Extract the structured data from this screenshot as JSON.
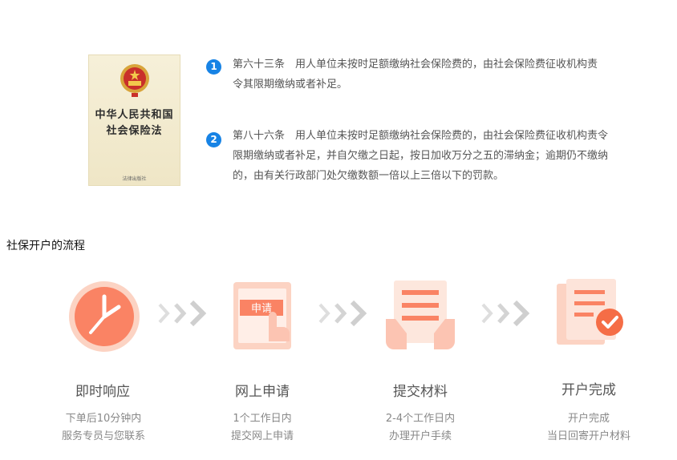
{
  "book": {
    "title_line1": "中华人民共和国",
    "title_line2": "社会保险法",
    "publisher": "法律出版社"
  },
  "articles": [
    {
      "number": "1",
      "line1": "第六十三条　用人单位未按时足额缴纳社会保险费的，由社会保险费征收机构责",
      "line2": "令其限期缴纳或者补足。"
    },
    {
      "number": "2",
      "line1": "第八十六条　用人单位未按时足额缴纳社会保险费的，由社会保险费征收机构责令",
      "line2": "限期缴纳或者补足，并自欠缴之日起，按日加收万分之五的滞纳金；逾期仍不缴纳",
      "line3": "的，由有关行政部门处欠缴数额一倍以上三倍以下的罚款。"
    }
  ],
  "section_title": "社保开户的流程",
  "steps": [
    {
      "title": "即时响应",
      "desc1": "下单后10分钟内",
      "desc2": "服务专员与您联系",
      "icon": "clock-icon"
    },
    {
      "title": "网上申请",
      "desc1": "1个工作日内",
      "desc2": "提交网上申请",
      "icon": "tablet-apply-icon",
      "icon_label": "申请"
    },
    {
      "title": "提交材料",
      "desc1": "2-4个工作日内",
      "desc2": "办理开户手续",
      "icon": "document-hands-icon"
    },
    {
      "title": "开户完成",
      "desc1": "开户完成",
      "desc2": "当日回寄开户材料",
      "icon": "files-check-icon"
    }
  ],
  "colors": {
    "accent": "#fa8364",
    "light": "#fcd3c3",
    "blue": "#1783e5",
    "chevron": "#d9d9d9"
  }
}
